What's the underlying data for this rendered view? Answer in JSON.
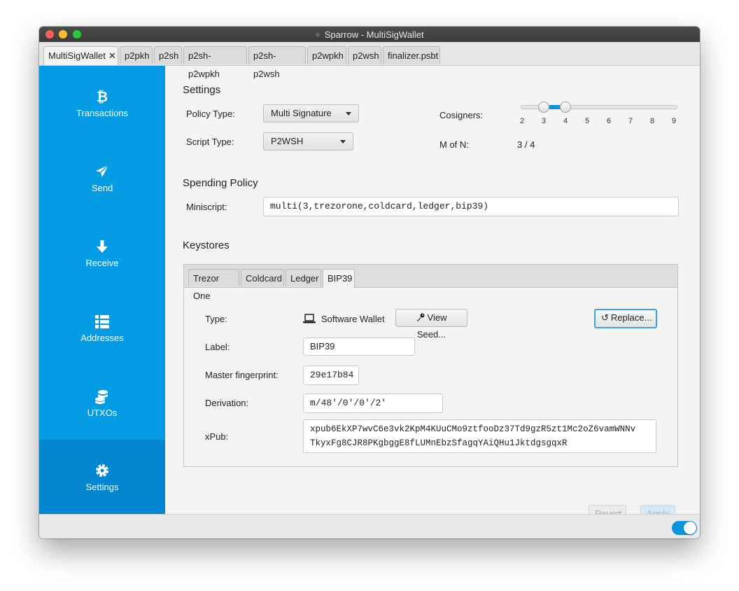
{
  "window": {
    "title": "Sparrow - MultiSigWallet"
  },
  "doc_tabs": [
    {
      "label": "MultiSigWallet",
      "close": "✕"
    },
    {
      "label": "p2pkh"
    },
    {
      "label": "p2sh"
    },
    {
      "label": "p2sh-p2wpkh"
    },
    {
      "label": "p2sh-p2wsh"
    },
    {
      "label": "p2wpkh"
    },
    {
      "label": "p2wsh"
    },
    {
      "label": "finalizer.psbt"
    }
  ],
  "sidebar": {
    "items": [
      {
        "label": "Transactions",
        "icon": "bitcoin-icon"
      },
      {
        "label": "Send",
        "icon": "paper-plane-icon"
      },
      {
        "label": "Receive",
        "icon": "arrow-down-icon"
      },
      {
        "label": "Addresses",
        "icon": "list-icon"
      },
      {
        "label": "UTXOs",
        "icon": "coins-icon"
      },
      {
        "label": "Settings",
        "icon": "gear-icon"
      }
    ],
    "active_index": 5,
    "accent": "#049ce4"
  },
  "settings": {
    "title": "Settings",
    "policy_type_label": "Policy Type:",
    "policy_type_value": "Multi Signature",
    "script_type_label": "Script Type:",
    "script_type_value": "P2WSH",
    "cosigners_label": "Cosigners:",
    "cosigners_ticks": [
      "2",
      "3",
      "4",
      "5",
      "6",
      "7",
      "8",
      "9"
    ],
    "cosigners_m": 3,
    "cosigners_n": 4,
    "m_of_n_label": "M of N:",
    "m_of_n_value": "3 / 4"
  },
  "spending_policy": {
    "title": "Spending Policy",
    "miniscript_label": "Miniscript:",
    "miniscript_value": "multi(3,trezorone,coldcard,ledger,bip39)"
  },
  "keystores": {
    "title": "Keystores",
    "tabs": [
      "Trezor One",
      "Coldcard",
      "Ledger",
      "BIP39"
    ],
    "active_tab": 3,
    "type_label": "Type:",
    "type_value": "Software Wallet",
    "view_seed_button": "View Seed...",
    "replace_button": "Replace...",
    "label_label": "Label:",
    "label_value": "BIP39",
    "fingerprint_label": "Master fingerprint:",
    "fingerprint_value": "29e17b84",
    "derivation_label": "Derivation:",
    "derivation_value": "m/48'/0'/0'/2'",
    "xpub_label": "xPub:",
    "xpub_line1": "xpub6EkXP7wvC6e3vk2KpM4KUuCMo9ztfooDz37Td9gzR5zt1Mc2oZ6vamWNNv",
    "xpub_line2": "TkyxFg8CJR8PKgbggE8fLUMnEbzSfagqYAiQHu1JktdgsgqxR"
  },
  "actions": {
    "revert": "Revert",
    "apply": "Apply"
  }
}
